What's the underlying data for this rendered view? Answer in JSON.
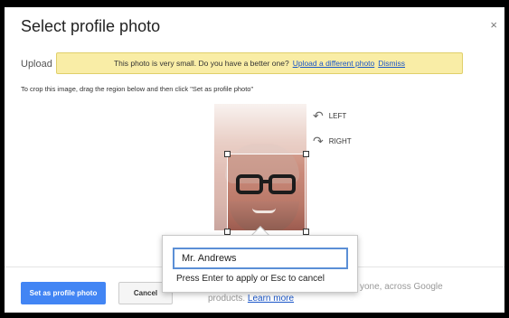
{
  "dialog": {
    "title": "Select profile photo",
    "close": "×"
  },
  "upload_tab": "Upload",
  "banner": {
    "message": "This photo is very small. Do you have a better one?",
    "upload_link": "Upload a different photo",
    "dismiss_link": "Dismiss"
  },
  "instructions": "To crop this image, drag the region below and then click \"Set as profile photo\"",
  "rotate": {
    "left_label": "LEFT",
    "right_label": "RIGHT",
    "left_icon": "rotate-left-icon",
    "right_icon": "rotate-right-icon"
  },
  "footer": {
    "primary_button": "Set as profile photo",
    "cancel_button": "Cancel",
    "trailing_text": "yone, across Google",
    "products_text": "products.",
    "learn_more": "Learn more"
  },
  "popup": {
    "input_value": "Mr. Andrews",
    "hint": "Press Enter to apply or Esc to cancel"
  },
  "colors": {
    "primary": "#4285f4",
    "banner_bg": "#f9eda6",
    "link": "#1a56c8"
  }
}
